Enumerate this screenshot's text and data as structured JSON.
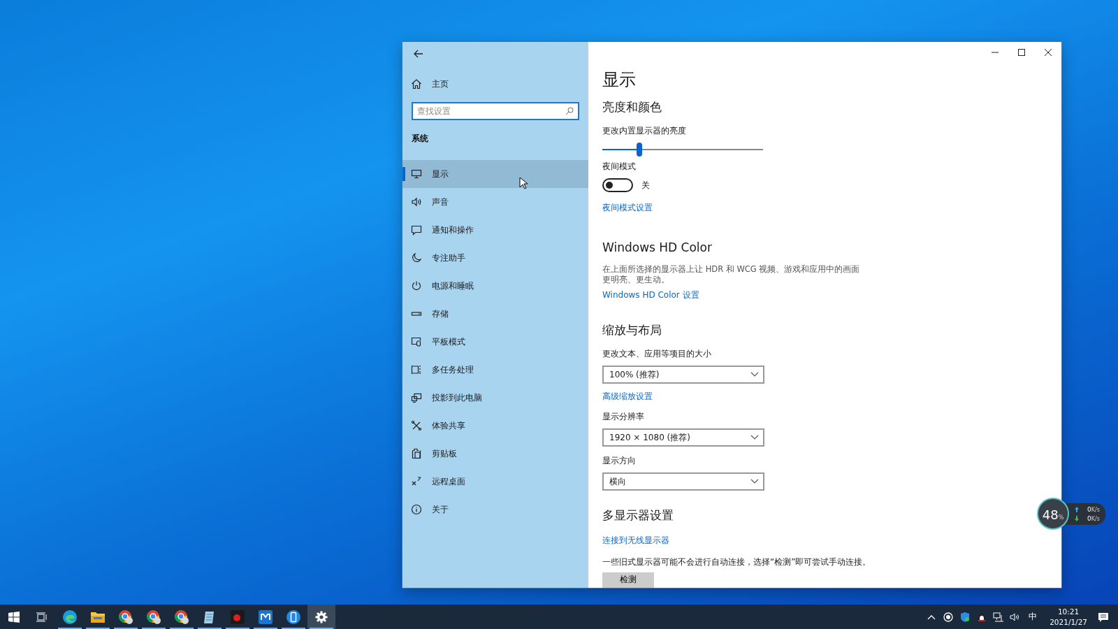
{
  "sidebar": {
    "home": "主页",
    "search": {
      "placeholder": "查找设置"
    },
    "section": "系统",
    "items": [
      {
        "label": "显示",
        "kind": "monitor",
        "selected": true
      },
      {
        "label": "声音",
        "kind": "speaker",
        "selected": false
      },
      {
        "label": "通知和操作",
        "kind": "message",
        "selected": false
      },
      {
        "label": "专注助手",
        "kind": "moon",
        "selected": false
      },
      {
        "label": "电源和睡眠",
        "kind": "power",
        "selected": false
      },
      {
        "label": "存储",
        "kind": "drive",
        "selected": false
      },
      {
        "label": "平板模式",
        "kind": "tablet",
        "selected": false
      },
      {
        "label": "多任务处理",
        "kind": "multitask",
        "selected": false
      },
      {
        "label": "投影到此电脑",
        "kind": "project",
        "selected": false
      },
      {
        "label": "体验共享",
        "kind": "share",
        "selected": false
      },
      {
        "label": "剪贴板",
        "kind": "clipboard",
        "selected": false
      },
      {
        "label": "远程桌面",
        "kind": "remote",
        "selected": false
      },
      {
        "label": "关于",
        "kind": "info",
        "selected": false
      }
    ]
  },
  "content": {
    "title": "显示",
    "brightness": {
      "heading": "亮度和颜色",
      "label": "更改内置显示器的亮度",
      "level": 0.23
    },
    "night_light": {
      "label": "夜间模式",
      "on": false,
      "state_text": "关",
      "link": "夜间模式设置"
    },
    "hd_color": {
      "heading": "Windows HD Color",
      "description": "在上面所选择的显示器上让 HDR 和 WCG 视频、游戏和应用中的画面更明亮、更生动。",
      "link": "Windows HD Color 设置"
    },
    "scale": {
      "heading": "缩放与布局",
      "fields": [
        {
          "label": "更改文本、应用等项目的大小",
          "value": "100% (推荐)",
          "link": "高级缩放设置"
        },
        {
          "label": "显示分辨率",
          "value": "1920 × 1080 (推荐)"
        },
        {
          "label": "显示方向",
          "value": "横向"
        }
      ]
    },
    "multi": {
      "heading": "多显示器设置",
      "link": "连接到无线显示器",
      "note": "一些旧式显示器可能不会进行自动连接，选择“检测”即可尝试手动连接。",
      "button": "检测"
    }
  },
  "net_widget": {
    "percent": "48",
    "unit": "%",
    "up": {
      "value": "0",
      "unit": "K/s"
    },
    "down": {
      "value": "0",
      "unit": "K/s"
    }
  },
  "taskbar": {
    "apps": [
      {
        "kind": "start",
        "running": false,
        "selected": false
      },
      {
        "kind": "taskview",
        "running": false,
        "selected": false
      },
      {
        "kind": "edge",
        "running": true,
        "selected": false
      },
      {
        "kind": "folder",
        "running": true,
        "selected": false
      },
      {
        "kind": "chrome",
        "running": true,
        "selected": false
      },
      {
        "kind": "chrome",
        "running": true,
        "selected": false
      },
      {
        "kind": "chrome",
        "running": true,
        "selected": false
      },
      {
        "kind": "notepad",
        "running": true,
        "selected": false
      },
      {
        "kind": "recorder",
        "running": true,
        "selected": false
      },
      {
        "kind": "maxthon",
        "running": true,
        "selected": false
      },
      {
        "kind": "phone",
        "running": true,
        "selected": false
      },
      {
        "kind": "settings",
        "running": true,
        "selected": true
      }
    ],
    "tray": {
      "ime": "中",
      "time": "10:21",
      "date": "2021/1/27"
    }
  }
}
